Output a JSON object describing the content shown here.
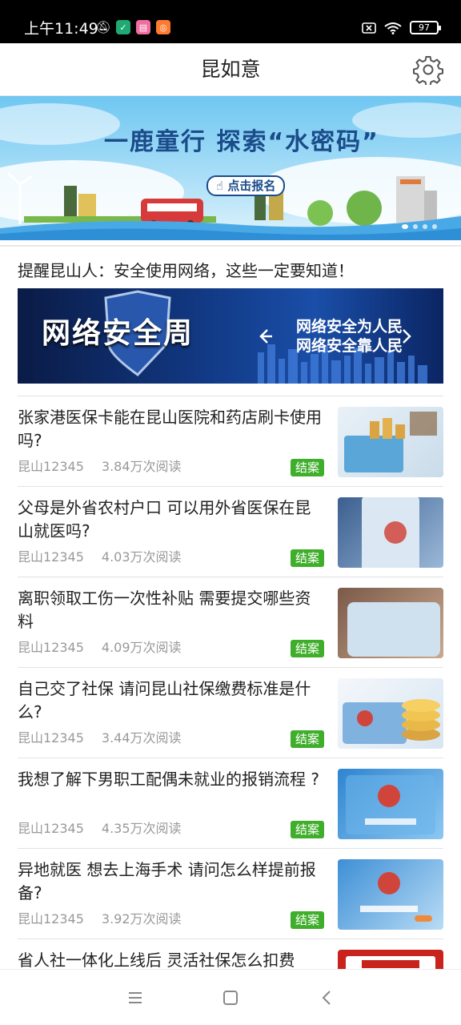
{
  "status_bar": {
    "time": "上午11:49",
    "battery": "97"
  },
  "header": {
    "title": "昆如意"
  },
  "banner": {
    "headline": "一鹿童行 探索“水密码”",
    "cta": "点击报名"
  },
  "notice": "提醒昆山人：安全使用网络，这些一定要知道！",
  "security_banner": {
    "title": "网络安全周",
    "line1": "网络安全为人民",
    "line2": "网络安全靠人民"
  },
  "articles": [
    {
      "title": "张家港医保卡能在昆山医院和药店刷卡使用吗?",
      "source": "昆山12345",
      "reads": "3.84万次阅读",
      "tag": "结案"
    },
    {
      "title": "父母是外省农村户口 可以用外省医保在昆山就医吗?",
      "source": "昆山12345",
      "reads": "4.03万次阅读",
      "tag": "结案"
    },
    {
      "title": "离职领取工伤一次性补贴 需要提交哪些资料",
      "source": "昆山12345",
      "reads": "4.09万次阅读",
      "tag": "结案"
    },
    {
      "title": "自己交了社保 请问昆山社保缴费标准是什么?",
      "source": "昆山12345",
      "reads": "3.44万次阅读",
      "tag": "结案"
    },
    {
      "title": "我想了解下男职工配偶未就业的报销流程 ?",
      "source": "昆山12345",
      "reads": "4.35万次阅读",
      "tag": "结案"
    },
    {
      "title": "异地就医 想去上海手术 请问怎么样提前报备?",
      "source": "昆山12345",
      "reads": "3.92万次阅读",
      "tag": "结案"
    },
    {
      "title": "省人社一体化上线后 灵活社保怎么扣费",
      "source": "",
      "reads": "",
      "tag": ""
    }
  ],
  "colors": {
    "tag_green": "#3fae2b",
    "banner_sky": "#6fc7f2",
    "security_blue": "#123a86"
  }
}
